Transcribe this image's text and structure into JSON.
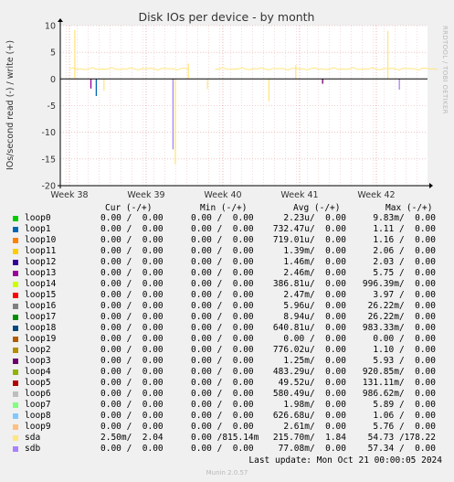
{
  "chart_data": {
    "type": "line",
    "title": "Disk IOs per device - by month",
    "ylabel": "IOs/second read (-) / write (+)",
    "xlabel": "",
    "ylim": [
      -20,
      10
    ],
    "yticks": [
      "10",
      "5",
      "0",
      "-5",
      "-10",
      "-15",
      "-20"
    ],
    "xticks": [
      "Week 38",
      "Week 39",
      "Week 40",
      "Week 41",
      "Week 42"
    ],
    "grid": true,
    "series": [
      {
        "name": "loop0",
        "color": "#00cc00"
      },
      {
        "name": "loop1",
        "color": "#0066b3"
      },
      {
        "name": "loop10",
        "color": "#ff8000"
      },
      {
        "name": "loop11",
        "color": "#ffcc00"
      },
      {
        "name": "loop12",
        "color": "#330099"
      },
      {
        "name": "loop13",
        "color": "#990099"
      },
      {
        "name": "loop14",
        "color": "#ccff00"
      },
      {
        "name": "loop15",
        "color": "#ff0000"
      },
      {
        "name": "loop16",
        "color": "#808080"
      },
      {
        "name": "loop17",
        "color": "#008f00"
      },
      {
        "name": "loop18",
        "color": "#00487d"
      },
      {
        "name": "loop19",
        "color": "#b35a00"
      },
      {
        "name": "loop2",
        "color": "#b38f00"
      },
      {
        "name": "loop3",
        "color": "#6b006b"
      },
      {
        "name": "loop4",
        "color": "#8fb300"
      },
      {
        "name": "loop5",
        "color": "#b30000"
      },
      {
        "name": "loop6",
        "color": "#bebebe"
      },
      {
        "name": "loop7",
        "color": "#80ff80"
      },
      {
        "name": "loop8",
        "color": "#80c9ff"
      },
      {
        "name": "loop9",
        "color": "#ffc080"
      },
      {
        "name": "sda",
        "color": "#ffe680"
      },
      {
        "name": "sdb",
        "color": "#aa80ff"
      }
    ],
    "read_spikes": [
      {
        "series": "sdb",
        "x": 1.35,
        "y": -13.2
      },
      {
        "series": "sda",
        "x": 1.38,
        "y": -16.0
      },
      {
        "series": "loop1",
        "x": 0.35,
        "y": -3.2
      },
      {
        "series": "loop13",
        "x": 0.28,
        "y": -1.8
      },
      {
        "series": "sda",
        "x": 0.45,
        "y": -2.2
      },
      {
        "series": "sda",
        "x": 2.6,
        "y": -4.2
      },
      {
        "series": "loop3",
        "x": 3.3,
        "y": -0.9
      },
      {
        "series": "sdb",
        "x": 4.3,
        "y": -2.0
      },
      {
        "series": "sda",
        "x": 1.8,
        "y": -1.9
      }
    ],
    "write_spikes": [
      {
        "series": "sda",
        "x": 0.07,
        "y": 9.2
      },
      {
        "series": "sda",
        "x": 4.15,
        "y": 9.0
      },
      {
        "series": "sda",
        "x": 1.55,
        "y": 2.9
      },
      {
        "series": "sda",
        "x": 2.95,
        "y": 2.6
      }
    ],
    "write_baseline": 1.9
  },
  "legend": {
    "headers": {
      "cur": "Cur (-/+)",
      "min": "Min (-/+)",
      "avg": "Avg (-/+)",
      "max": "Max (-/+)"
    },
    "rows": [
      {
        "name": "loop0",
        "cur": "0.00 /  0.00",
        "min": "0.00 /  0.00",
        "avg": "2.23u/  0.00",
        "max": "9.83m/  0.00"
      },
      {
        "name": "loop1",
        "cur": "0.00 /  0.00",
        "min": "0.00 /  0.00",
        "avg": "732.47u/  0.00",
        "max": "1.11 /  0.00"
      },
      {
        "name": "loop10",
        "cur": "0.00 /  0.00",
        "min": "0.00 /  0.00",
        "avg": "719.01u/  0.00",
        "max": "1.16 /  0.00"
      },
      {
        "name": "loop11",
        "cur": "0.00 /  0.00",
        "min": "0.00 /  0.00",
        "avg": "1.39m/  0.00",
        "max": "2.06 /  0.00"
      },
      {
        "name": "loop12",
        "cur": "0.00 /  0.00",
        "min": "0.00 /  0.00",
        "avg": "1.46m/  0.00",
        "max": "2.03 /  0.00"
      },
      {
        "name": "loop13",
        "cur": "0.00 /  0.00",
        "min": "0.00 /  0.00",
        "avg": "2.46m/  0.00",
        "max": "5.75 /  0.00"
      },
      {
        "name": "loop14",
        "cur": "0.00 /  0.00",
        "min": "0.00 /  0.00",
        "avg": "386.81u/  0.00",
        "max": "996.39m/  0.00"
      },
      {
        "name": "loop15",
        "cur": "0.00 /  0.00",
        "min": "0.00 /  0.00",
        "avg": "2.47m/  0.00",
        "max": "3.97 /  0.00"
      },
      {
        "name": "loop16",
        "cur": "0.00 /  0.00",
        "min": "0.00 /  0.00",
        "avg": "5.96u/  0.00",
        "max": "26.22m/  0.00"
      },
      {
        "name": "loop17",
        "cur": "0.00 /  0.00",
        "min": "0.00 /  0.00",
        "avg": "8.94u/  0.00",
        "max": "26.22m/  0.00"
      },
      {
        "name": "loop18",
        "cur": "0.00 /  0.00",
        "min": "0.00 /  0.00",
        "avg": "640.81u/  0.00",
        "max": "983.33m/  0.00"
      },
      {
        "name": "loop19",
        "cur": "0.00 /  0.00",
        "min": "0.00 /  0.00",
        "avg": "0.00 /  0.00",
        "max": "0.00 /  0.00"
      },
      {
        "name": "loop2",
        "cur": "0.00 /  0.00",
        "min": "0.00 /  0.00",
        "avg": "776.02u/  0.00",
        "max": "1.10 /  0.00"
      },
      {
        "name": "loop3",
        "cur": "0.00 /  0.00",
        "min": "0.00 /  0.00",
        "avg": "1.25m/  0.00",
        "max": "5.93 /  0.00"
      },
      {
        "name": "loop4",
        "cur": "0.00 /  0.00",
        "min": "0.00 /  0.00",
        "avg": "483.29u/  0.00",
        "max": "920.85m/  0.00"
      },
      {
        "name": "loop5",
        "cur": "0.00 /  0.00",
        "min": "0.00 /  0.00",
        "avg": "49.52u/  0.00",
        "max": "131.11m/  0.00"
      },
      {
        "name": "loop6",
        "cur": "0.00 /  0.00",
        "min": "0.00 /  0.00",
        "avg": "580.49u/  0.00",
        "max": "986.62m/  0.00"
      },
      {
        "name": "loop7",
        "cur": "0.00 /  0.00",
        "min": "0.00 /  0.00",
        "avg": "1.98m/  0.00",
        "max": "5.89 /  0.00"
      },
      {
        "name": "loop8",
        "cur": "0.00 /  0.00",
        "min": "0.00 /  0.00",
        "avg": "626.68u/  0.00",
        "max": "1.06 /  0.00"
      },
      {
        "name": "loop9",
        "cur": "0.00 /  0.00",
        "min": "0.00 /  0.00",
        "avg": "2.61m/  0.00",
        "max": "5.76 /  0.00"
      },
      {
        "name": "sda",
        "cur": "2.50m/  2.04",
        "min": "0.00 /815.14m",
        "avg": "215.70m/  1.84",
        "max": "54.73 /178.22"
      },
      {
        "name": "sdb",
        "cur": "0.00 /  0.00",
        "min": "0.00 /  0.00",
        "avg": "77.08m/  0.00",
        "max": "57.34 /  0.00"
      }
    ]
  },
  "last_update": "Last update: Mon Oct 21 00:00:05 2024",
  "credit": "Munin 2.0.57",
  "sideways_label": "RRDTOOL / TOBI OETIKER"
}
